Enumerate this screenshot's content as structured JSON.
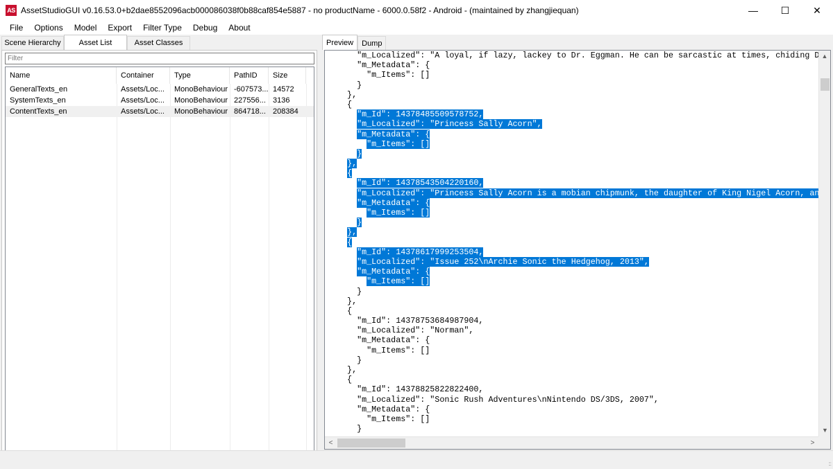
{
  "window": {
    "app_icon_text": "AS",
    "title": "AssetStudioGUI v0.16.53.0+b2dae8552096acb000086038f0b88caf854e5887 - no productName - 6000.0.58f2 - Android - (maintained by zhangjiequan)",
    "minimize_glyph": "—",
    "maximize_glyph": "☐",
    "close_glyph": "✕"
  },
  "menu": [
    "File",
    "Options",
    "Model",
    "Export",
    "Filter Type",
    "Debug",
    "About"
  ],
  "left_tabs": [
    "Scene Hierarchy",
    "Asset List",
    "Asset Classes"
  ],
  "filter": {
    "placeholder": "Filter"
  },
  "asset_list": {
    "columns": [
      "Name",
      "Container",
      "Type",
      "PathID",
      "Size"
    ],
    "rows": [
      [
        "GeneralTexts_en",
        "Assets/Loc...",
        "MonoBehaviour",
        "-607573...",
        "14572"
      ],
      [
        "SystemTexts_en",
        "Assets/Loc...",
        "MonoBehaviour",
        "227556...",
        "3136"
      ],
      [
        "ContentTexts_en",
        "Assets/Loc...",
        "MonoBehaviour",
        "864718...",
        "208384"
      ]
    ],
    "selected_row": 2
  },
  "progress": {
    "fraction": 1.0,
    "color": "#06b025"
  },
  "right_tabs": [
    "Preview",
    "Dump"
  ],
  "preview": {
    "lines": [
      {
        "text": "      \"m_Localized\": \"A loyal, if lazy, lackey to Dr. Eggman. He can be sarcastic at times, chiding Dr. Eg",
        "hl": false
      },
      {
        "text": "      \"m_Metadata\": {",
        "hl": false
      },
      {
        "text": "        \"m_Items\": []",
        "hl": false
      },
      {
        "text": "      }",
        "hl": false
      },
      {
        "text": "    },",
        "hl": false
      },
      {
        "text": "    {",
        "hl": false
      },
      {
        "text": "      \"m_Id\": 14378485509578752,",
        "hl": true
      },
      {
        "text": "      \"m_Localized\": \"Princess Sally Acorn\",",
        "hl": true
      },
      {
        "text": "      \"m_Metadata\": {",
        "hl": true
      },
      {
        "text": "        \"m_Items\": []",
        "hl": true
      },
      {
        "text": "      }",
        "hl": true
      },
      {
        "text": "    },",
        "hl": true
      },
      {
        "text": "    {",
        "hl": true
      },
      {
        "text": "      \"m_Id\": 14378543504220160,",
        "hl": true
      },
      {
        "text": "      \"m_Localized\": \"Princess Sally Acorn is a mobian chipmunk, the daughter of King Nigel Acorn, and lea",
        "hl": true
      },
      {
        "text": "      \"m_Metadata\": {",
        "hl": true
      },
      {
        "text": "        \"m_Items\": []",
        "hl": true
      },
      {
        "text": "      }",
        "hl": true
      },
      {
        "text": "    },",
        "hl": true
      },
      {
        "text": "    {",
        "hl": true
      },
      {
        "text": "      \"m_Id\": 14378617999253504,",
        "hl": true
      },
      {
        "text": "      \"m_Localized\": \"Issue 252\\nArchie Sonic the Hedgehog, 2013\",",
        "hl": true
      },
      {
        "text": "      \"m_Metadata\": {",
        "hl": true
      },
      {
        "text": "        \"m_Items\": []",
        "hl": true
      },
      {
        "text": "      }",
        "hl": false
      },
      {
        "text": "    },",
        "hl": false
      },
      {
        "text": "    {",
        "hl": false
      },
      {
        "text": "      \"m_Id\": 14378753684987904,",
        "hl": false
      },
      {
        "text": "      \"m_Localized\": \"Norman\",",
        "hl": false
      },
      {
        "text": "      \"m_Metadata\": {",
        "hl": false
      },
      {
        "text": "        \"m_Items\": []",
        "hl": false
      },
      {
        "text": "      }",
        "hl": false
      },
      {
        "text": "    },",
        "hl": false
      },
      {
        "text": "    {",
        "hl": false
      },
      {
        "text": "      \"m_Id\": 14378825822822400,",
        "hl": false
      },
      {
        "text": "      \"m_Localized\": \"Sonic Rush Adventures\\nNintendo DS/3DS, 2007\",",
        "hl": false
      },
      {
        "text": "      \"m_Metadata\": {",
        "hl": false
      },
      {
        "text": "        \"m_Items\": []",
        "hl": false
      },
      {
        "text": "      }",
        "hl": false
      }
    ],
    "highlight_color": "#0078d7"
  },
  "scrollbars": {
    "up": "▲",
    "down": "▼",
    "left": "<",
    "right": ">"
  },
  "status": {
    "grip": ":::"
  }
}
